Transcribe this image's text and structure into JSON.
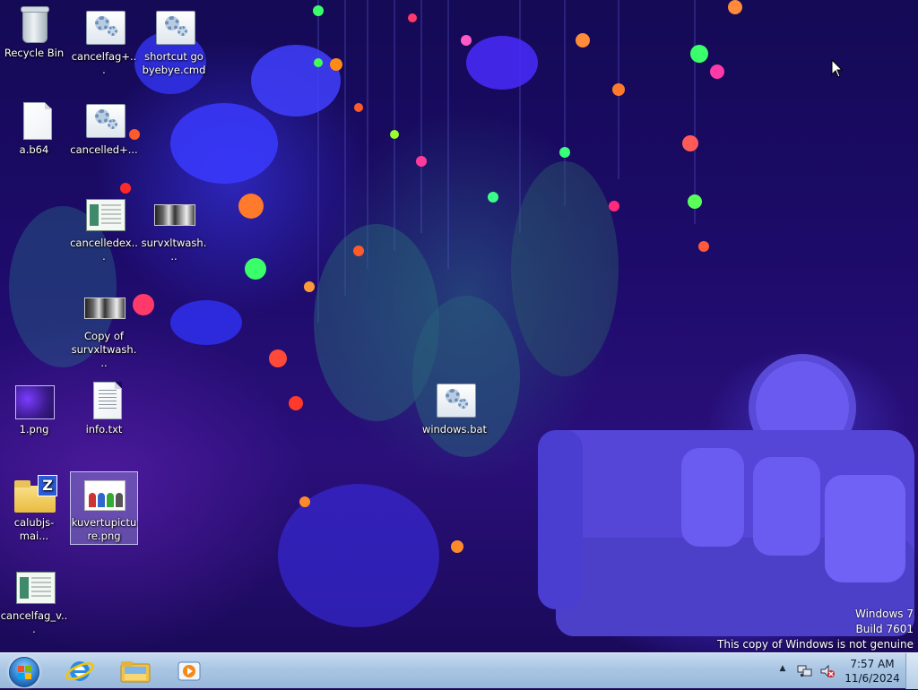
{
  "desktop": {
    "icons": [
      {
        "label": "Recycle Bin",
        "icon": "recycle-bin-icon"
      },
      {
        "label": "cancelfag+...",
        "icon": "batch-file-icon"
      },
      {
        "label": "shortcut go byebye.cmd",
        "icon": "batch-file-icon"
      },
      {
        "label": "a.b64",
        "icon": "blank-file-icon"
      },
      {
        "label": "cancelled+...",
        "icon": "batch-file-icon"
      },
      {
        "label": "cancelledex...",
        "icon": "application-icon"
      },
      {
        "label": "survxltwash...",
        "icon": "image-thumbnail-icon"
      },
      {
        "label": "Copy of survxltwash...",
        "icon": "image-thumbnail-icon"
      },
      {
        "label": "1.png",
        "icon": "png-image-icon"
      },
      {
        "label": "info.txt",
        "icon": "text-file-icon"
      },
      {
        "label": "windows.bat",
        "icon": "batch-file-icon"
      },
      {
        "label": "calubjs-mai...",
        "icon": "zipped-folder-icon"
      },
      {
        "label": "kuvertupicture.png",
        "icon": "png-image-icon",
        "selected": true
      },
      {
        "label": "cancelfag_v...",
        "icon": "application-icon"
      }
    ]
  },
  "watermark": {
    "line1": "Windows 7",
    "line2": "Build 7601",
    "line3": "This copy of Windows is not genuine"
  },
  "taskbar": {
    "start_icon": "windows-start-orb-icon",
    "pinned": [
      {
        "name": "Internet Explorer",
        "icon": "internet-explorer-icon"
      },
      {
        "name": "Windows Explorer",
        "icon": "file-explorer-icon"
      },
      {
        "name": "Windows Media Player",
        "icon": "media-player-icon"
      }
    ],
    "tray": {
      "arrow_glyph": "▲",
      "network_icon": "network-icon",
      "volume_icon": "volume-muted-icon"
    },
    "clock": {
      "time": "7:57 AM",
      "date": "11/6/2024"
    }
  },
  "colors": {
    "taskbar": "#a9c6e4",
    "wallpaper_base": "#1d0b6a",
    "selection": "#c8dcff"
  }
}
